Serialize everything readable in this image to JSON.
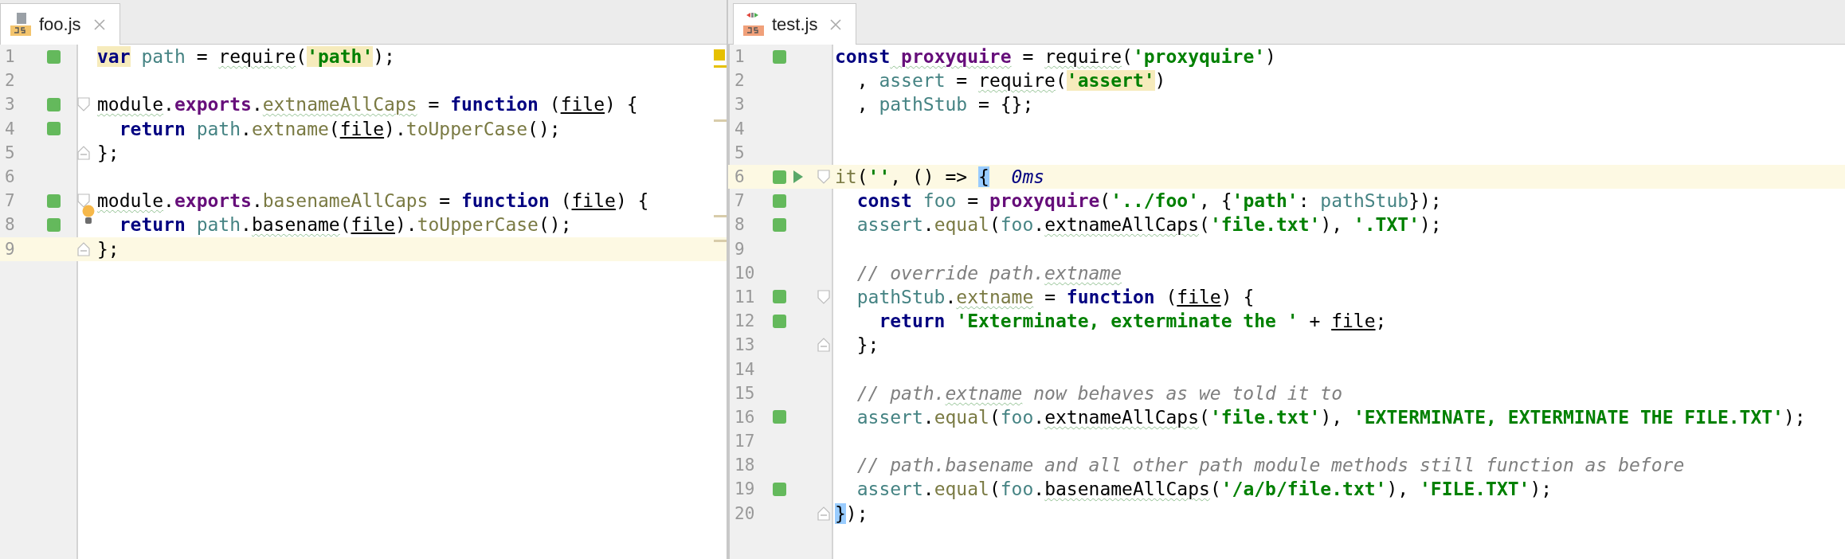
{
  "panes": [
    {
      "tab": {
        "label": "foo.js",
        "selected": true,
        "test": false
      },
      "lines": [
        {
          "number": "1",
          "covered": true,
          "current": false,
          "tokens": [
            {
              "text": "var",
              "kind": "keyword",
              "highlighted": true
            },
            {
              "text": " path",
              "kind": "variable"
            },
            {
              "text": " = ",
              "kind": "plain"
            },
            {
              "text": "require",
              "kind": "plain",
              "wavy": true
            },
            {
              "text": "(",
              "kind": "plain"
            },
            {
              "text": "'path'",
              "kind": "string",
              "highlighted": true
            },
            {
              "text": ");",
              "kind": "plain"
            }
          ]
        },
        {
          "number": "2",
          "covered": false,
          "current": false
        },
        {
          "number": "3",
          "covered": true,
          "current": false,
          "fold_start": true,
          "tokens": [
            {
              "text": "module",
              "kind": "plain",
              "wavy": true
            },
            {
              "text": ".",
              "kind": "plain"
            },
            {
              "text": "exports",
              "kind": "property"
            },
            {
              "text": ".",
              "kind": "plain"
            },
            {
              "text": "extnameAllCaps",
              "kind": "function",
              "wavy": true
            },
            {
              "text": " = ",
              "kind": "plain"
            },
            {
              "text": "function",
              "kind": "keyword"
            },
            {
              "text": " (",
              "kind": "plain"
            },
            {
              "text": "file",
              "kind": "param"
            },
            {
              "text": ") {",
              "kind": "plain"
            }
          ]
        },
        {
          "number": "4",
          "covered": true,
          "current": false,
          "tokens": [
            {
              "text": "  return",
              "kind": "keyword"
            },
            {
              "text": " path",
              "kind": "variable"
            },
            {
              "text": ".",
              "kind": "plain"
            },
            {
              "text": "extname",
              "kind": "function"
            },
            {
              "text": "(",
              "kind": "plain"
            },
            {
              "text": "file",
              "kind": "param"
            },
            {
              "text": ").",
              "kind": "plain"
            },
            {
              "text": "toUpperCase",
              "kind": "function"
            },
            {
              "text": "();",
              "kind": "plain"
            }
          ]
        },
        {
          "number": "5",
          "covered": false,
          "current": false,
          "fold_end": true,
          "tokens": [
            {
              "text": "};",
              "kind": "plain"
            }
          ]
        },
        {
          "number": "6",
          "covered": false,
          "current": false
        },
        {
          "number": "7",
          "covered": true,
          "current": false,
          "fold_start": true,
          "tokens": [
            {
              "text": "module",
              "kind": "plain",
              "wavy": true
            },
            {
              "text": ".",
              "kind": "plain"
            },
            {
              "text": "exports",
              "kind": "property"
            },
            {
              "text": ".",
              "kind": "plain"
            },
            {
              "text": "basenameAllCaps",
              "kind": "function"
            },
            {
              "text": " = ",
              "kind": "plain"
            },
            {
              "text": "function",
              "kind": "keyword"
            },
            {
              "text": " (",
              "kind": "plain"
            },
            {
              "text": "file",
              "kind": "param"
            },
            {
              "text": ") {",
              "kind": "plain"
            }
          ]
        },
        {
          "number": "8",
          "covered": true,
          "current": false,
          "intention": true,
          "tokens": [
            {
              "text": "  return",
              "kind": "keyword"
            },
            {
              "text": " path",
              "kind": "variable"
            },
            {
              "text": ".",
              "kind": "plain"
            },
            {
              "text": "basename",
              "kind": "plain",
              "wavy": true
            },
            {
              "text": "(",
              "kind": "plain"
            },
            {
              "text": "file",
              "kind": "param"
            },
            {
              "text": ").",
              "kind": "plain"
            },
            {
              "text": "toUpperCase",
              "kind": "function"
            },
            {
              "text": "();",
              "kind": "plain"
            }
          ]
        },
        {
          "number": "9",
          "covered": false,
          "current": true,
          "fold_end": true,
          "tokens": [
            {
              "text": "};",
              "kind": "plain"
            }
          ]
        }
      ]
    },
    {
      "tab": {
        "label": "test.js",
        "selected": true,
        "test": true
      },
      "lines": [
        {
          "number": "1",
          "covered": true,
          "current": false,
          "tokens": [
            {
              "text": "const",
              "kind": "keyword"
            },
            {
              "text": " proxyquire",
              "kind": "property",
              "wavy": true
            },
            {
              "text": " = ",
              "kind": "plain"
            },
            {
              "text": "require",
              "kind": "plain",
              "wavy": true
            },
            {
              "text": "(",
              "kind": "plain"
            },
            {
              "text": "'proxyquire'",
              "kind": "string"
            },
            {
              "text": ")",
              "kind": "plain"
            }
          ]
        },
        {
          "number": "2",
          "covered": false,
          "current": false,
          "tokens": [
            {
              "text": "  , ",
              "kind": "plain"
            },
            {
              "text": "assert",
              "kind": "variable"
            },
            {
              "text": " = ",
              "kind": "plain"
            },
            {
              "text": "require",
              "kind": "plain",
              "wavy": true
            },
            {
              "text": "(",
              "kind": "plain"
            },
            {
              "text": "'assert'",
              "kind": "string",
              "highlighted": true
            },
            {
              "text": ")",
              "kind": "plain"
            }
          ]
        },
        {
          "number": "3",
          "covered": false,
          "current": false,
          "tokens": [
            {
              "text": "  , ",
              "kind": "plain"
            },
            {
              "text": "pathStub",
              "kind": "variable"
            },
            {
              "text": " = {};",
              "kind": "plain"
            }
          ]
        },
        {
          "number": "4",
          "covered": false,
          "current": false
        },
        {
          "number": "5",
          "covered": false,
          "current": false
        },
        {
          "number": "6",
          "covered": true,
          "current": true,
          "runnable": true,
          "fold_start": true,
          "tokens": [
            {
              "text": "it",
              "kind": "function"
            },
            {
              "text": "(",
              "kind": "plain"
            },
            {
              "text": "''",
              "kind": "string"
            },
            {
              "text": ", () => ",
              "kind": "plain"
            },
            {
              "text": "{",
              "kind": "plain",
              "matched": true
            },
            {
              "text": "  0ms",
              "kind": "hint"
            }
          ]
        },
        {
          "number": "7",
          "covered": true,
          "current": false,
          "tokens": [
            {
              "text": "  const",
              "kind": "keyword"
            },
            {
              "text": " foo",
              "kind": "variable"
            },
            {
              "text": " = ",
              "kind": "plain"
            },
            {
              "text": "proxyquire",
              "kind": "property"
            },
            {
              "text": "(",
              "kind": "plain"
            },
            {
              "text": "'../foo'",
              "kind": "string"
            },
            {
              "text": ", {",
              "kind": "plain"
            },
            {
              "text": "'path'",
              "kind": "string"
            },
            {
              "text": ": ",
              "kind": "plain"
            },
            {
              "text": "pathStub",
              "kind": "variable"
            },
            {
              "text": "});",
              "kind": "plain"
            }
          ]
        },
        {
          "number": "8",
          "covered": true,
          "current": false,
          "tokens": [
            {
              "text": "  assert",
              "kind": "variable"
            },
            {
              "text": ".",
              "kind": "plain"
            },
            {
              "text": "equal",
              "kind": "function"
            },
            {
              "text": "(",
              "kind": "plain"
            },
            {
              "text": "foo",
              "kind": "variable"
            },
            {
              "text": ".",
              "kind": "plain"
            },
            {
              "text": "extnameAllCaps",
              "kind": "plain",
              "wavy": true
            },
            {
              "text": "(",
              "kind": "plain"
            },
            {
              "text": "'file.txt'",
              "kind": "string"
            },
            {
              "text": "), ",
              "kind": "plain"
            },
            {
              "text": "'.TXT'",
              "kind": "string"
            },
            {
              "text": ");",
              "kind": "plain"
            }
          ]
        },
        {
          "number": "9",
          "covered": false,
          "current": false
        },
        {
          "number": "10",
          "covered": false,
          "current": false,
          "tokens": [
            {
              "text": "  // override path.",
              "kind": "comment"
            },
            {
              "text": "extname",
              "kind": "comment",
              "wavy": true
            }
          ]
        },
        {
          "number": "11",
          "covered": true,
          "current": false,
          "fold_start": true,
          "tokens": [
            {
              "text": "  pathStub",
              "kind": "variable"
            },
            {
              "text": ".",
              "kind": "plain"
            },
            {
              "text": "extname",
              "kind": "function",
              "wavy": true
            },
            {
              "text": " = ",
              "kind": "plain"
            },
            {
              "text": "function",
              "kind": "keyword"
            },
            {
              "text": " (",
              "kind": "plain"
            },
            {
              "text": "file",
              "kind": "param"
            },
            {
              "text": ") {",
              "kind": "plain"
            }
          ]
        },
        {
          "number": "12",
          "covered": true,
          "current": false,
          "tokens": [
            {
              "text": "    return",
              "kind": "keyword"
            },
            {
              "text": " 'Exterminate, exterminate the '",
              "kind": "string"
            },
            {
              "text": " + ",
              "kind": "plain"
            },
            {
              "text": "file",
              "kind": "param"
            },
            {
              "text": ";",
              "kind": "plain"
            }
          ]
        },
        {
          "number": "13",
          "covered": false,
          "current": false,
          "fold_end": true,
          "tokens": [
            {
              "text": "  };",
              "kind": "plain"
            }
          ]
        },
        {
          "number": "14",
          "covered": false,
          "current": false
        },
        {
          "number": "15",
          "covered": false,
          "current": false,
          "tokens": [
            {
              "text": "  // path.",
              "kind": "comment"
            },
            {
              "text": "extname",
              "kind": "comment",
              "wavy": true
            },
            {
              "text": " now behaves as we told it to",
              "kind": "comment"
            }
          ]
        },
        {
          "number": "16",
          "covered": true,
          "current": false,
          "tokens": [
            {
              "text": "  assert",
              "kind": "variable"
            },
            {
              "text": ".",
              "kind": "plain"
            },
            {
              "text": "equal",
              "kind": "function"
            },
            {
              "text": "(",
              "kind": "plain"
            },
            {
              "text": "foo",
              "kind": "variable"
            },
            {
              "text": ".",
              "kind": "plain"
            },
            {
              "text": "extnameAllCaps",
              "kind": "plain",
              "wavy": true
            },
            {
              "text": "(",
              "kind": "plain"
            },
            {
              "text": "'file.txt'",
              "kind": "string"
            },
            {
              "text": "), ",
              "kind": "plain"
            },
            {
              "text": "'EXTERMINATE, EXTERMINATE THE FILE.TXT'",
              "kind": "string"
            },
            {
              "text": ");",
              "kind": "plain"
            }
          ]
        },
        {
          "number": "17",
          "covered": false,
          "current": false
        },
        {
          "number": "18",
          "covered": false,
          "current": false,
          "tokens": [
            {
              "text": "  // path.basename and all other path module methods still function as before",
              "kind": "comment"
            }
          ]
        },
        {
          "number": "19",
          "covered": true,
          "current": false,
          "tokens": [
            {
              "text": "  assert",
              "kind": "variable"
            },
            {
              "text": ".",
              "kind": "plain"
            },
            {
              "text": "equal",
              "kind": "function"
            },
            {
              "text": "(",
              "kind": "plain"
            },
            {
              "text": "foo",
              "kind": "variable"
            },
            {
              "text": ".",
              "kind": "plain"
            },
            {
              "text": "basenameAllCaps",
              "kind": "plain",
              "wavy": true
            },
            {
              "text": "(",
              "kind": "plain"
            },
            {
              "text": "'/a/b/file.txt'",
              "kind": "string"
            },
            {
              "text": "), ",
              "kind": "plain"
            },
            {
              "text": "'FILE.TXT'",
              "kind": "string"
            },
            {
              "text": ");",
              "kind": "plain"
            }
          ]
        },
        {
          "number": "20",
          "covered": false,
          "current": false,
          "fold_end": true,
          "tokens": [
            {
              "text": "}",
              "kind": "plain",
              "matched": true
            },
            {
              "text": ");",
              "kind": "plain"
            }
          ]
        }
      ]
    }
  ]
}
